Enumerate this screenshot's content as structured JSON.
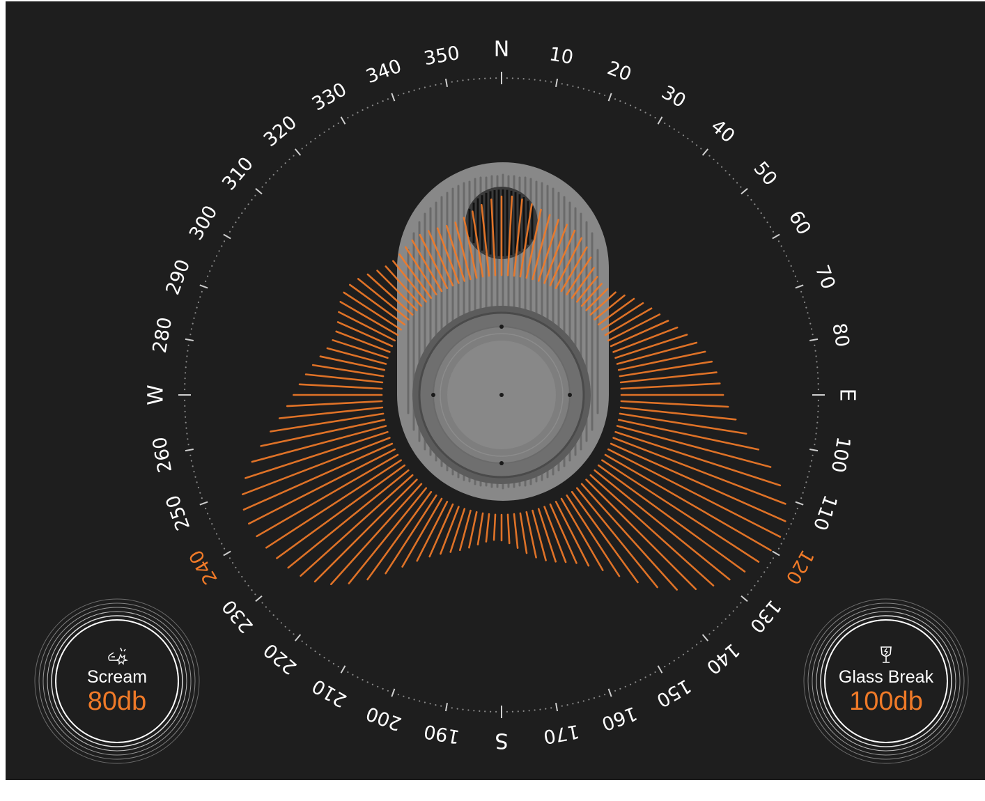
{
  "compass": {
    "cardinals": {
      "0": "N",
      "90": "E",
      "180": "S",
      "270": "W"
    },
    "degree_labels": [
      10,
      20,
      30,
      40,
      50,
      60,
      70,
      80,
      100,
      110,
      120,
      130,
      140,
      150,
      160,
      170,
      190,
      200,
      210,
      220,
      230,
      240,
      250,
      260,
      280,
      290,
      300,
      310,
      320,
      330,
      340,
      350
    ],
    "highlighted_degrees": [
      120,
      240
    ],
    "colors": {
      "text": "#ffffff",
      "highlight": "#f07a28",
      "ticks": "#cfcfcf",
      "dots": "#8a8a8a"
    }
  },
  "sound_map": {
    "color": "#f07a28",
    "peak_directions_deg": [
      0,
      120,
      240
    ],
    "device": "microphone-array"
  },
  "events": [
    {
      "name": "Scream",
      "level": "80db",
      "icon": "scream-icon"
    },
    {
      "name": "Glass Break",
      "level": "100db",
      "icon": "glass-break-icon"
    }
  ],
  "colors": {
    "background": "#1e1e1e",
    "accent": "#f07a28",
    "device_body": "#8e8e8e",
    "device_dark": "#5f5f5f"
  }
}
